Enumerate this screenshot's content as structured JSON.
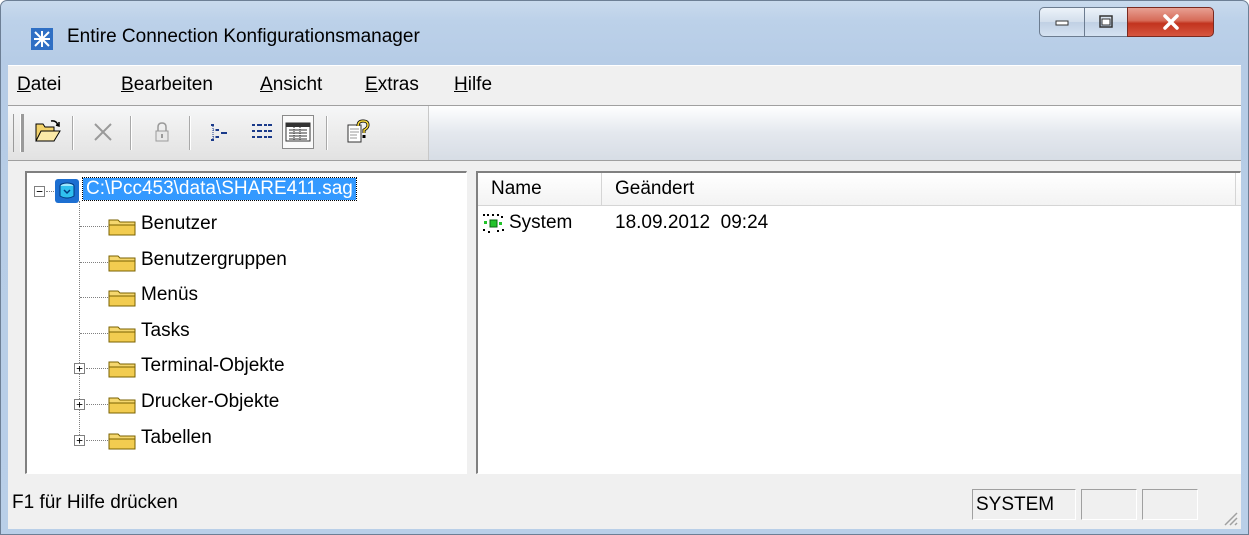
{
  "window": {
    "title": "Entire Connection Konfigurationsmanager"
  },
  "colors": {
    "selection": "#3399ff",
    "folder": "#f5d76e",
    "close": "#c2331e"
  },
  "menubar": {
    "items": [
      {
        "label": "Datei",
        "accel": "D",
        "rest": "atei"
      },
      {
        "label": "Bearbeiten",
        "accel": "B",
        "rest": "earbeiten"
      },
      {
        "label": "Ansicht",
        "accel": "A",
        "rest": "nsicht"
      },
      {
        "label": "Extras",
        "accel": "E",
        "rest": "xtras"
      },
      {
        "label": "Hilfe",
        "accel": "H",
        "rest": "ilfe"
      }
    ]
  },
  "toolbar": {
    "buttons": [
      {
        "name": "open",
        "icon": "open-folder-icon"
      },
      {
        "name": "delete",
        "icon": "delete-x-icon"
      },
      {
        "name": "lock",
        "icon": "lock-icon"
      },
      {
        "name": "tree-view",
        "icon": "tree-view-icon"
      },
      {
        "name": "list-view",
        "icon": "list-view-icon"
      },
      {
        "name": "details-view",
        "icon": "details-view-icon"
      },
      {
        "name": "help",
        "icon": "context-help-icon"
      }
    ]
  },
  "tree": {
    "root": {
      "label": "C:\\Pcc453\\data\\SHARE411.sag",
      "expanded": true,
      "icon": "database-icon"
    },
    "children": [
      {
        "label": "Benutzer",
        "expandable": false
      },
      {
        "label": "Benutzergruppen",
        "expandable": false
      },
      {
        "label": "Menüs",
        "expandable": false
      },
      {
        "label": "Tasks",
        "expandable": false
      },
      {
        "label": "Terminal-Objekte",
        "expandable": true
      },
      {
        "label": "Drucker-Objekte",
        "expandable": true
      },
      {
        "label": "Tabellen",
        "expandable": true
      }
    ]
  },
  "list": {
    "columns": [
      "Name",
      "Geändert"
    ],
    "rows": [
      {
        "name": "System",
        "changed": "18.09.2012  09:24",
        "icon": "user-group-icon"
      }
    ]
  },
  "statusbar": {
    "text": "F1 für Hilfe drücken",
    "panels": [
      "SYSTEM",
      "",
      ""
    ]
  }
}
